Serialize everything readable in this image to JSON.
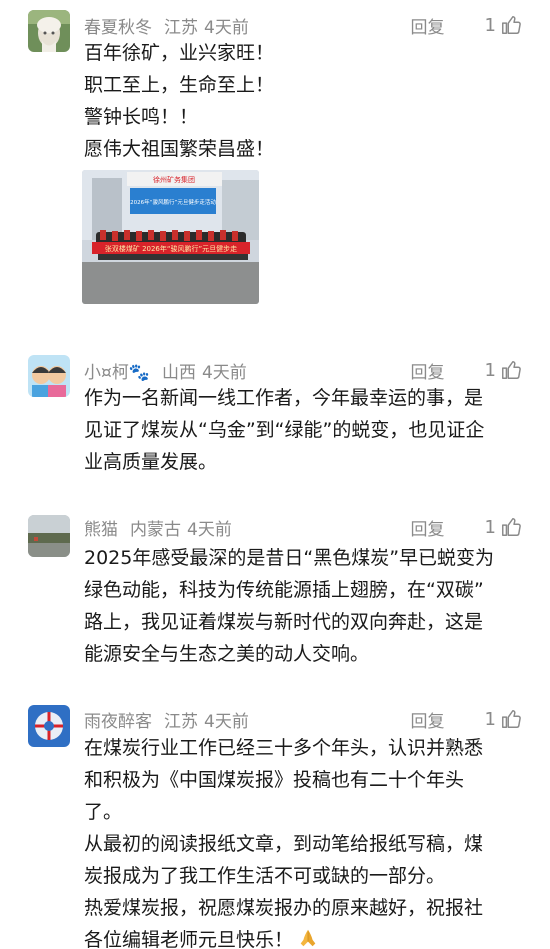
{
  "comments": [
    {
      "user": "春夏秋冬",
      "location": "江苏",
      "time": "4天前",
      "reply_label": "回复",
      "likes": "1",
      "lines": [
        "百年徐矿，业兴家旺！",
        "职工至上，生命至上！",
        "警钟长鸣！！",
        "愿伟大祖国繁荣昌盛！"
      ],
      "photo": {
        "banner_text": "张双楼煤矿 2026年“骏风鹏行”元旦健步走",
        "screen_text": "2026年“骏风鹏行”元旦健步走活动",
        "logo_text": "徐州矿务集团"
      }
    },
    {
      "user": "小¤柯🐾",
      "location": "山西",
      "time": "4天前",
      "reply_label": "回复",
      "likes": "1",
      "lines": [
        "作为一名新闻一线工作者，今年最幸运的事，是",
        "见证了煤炭从“乌金”到“绿能”的蜕变，也见证企",
        "业高质量发展。"
      ]
    },
    {
      "user": "熊猫",
      "location": "内蒙古",
      "time": "4天前",
      "reply_label": "回复",
      "likes": "1",
      "lines": [
        "2025年感受最深的是昔日“黑色煤炭”早已蜕变为",
        "绿色动能，科技为传统能源插上翅膀，在“双碳”",
        "路上，我见证着煤炭与新时代的双向奔赴，这是",
        "能源安全与生态之美的动人交响。"
      ]
    },
    {
      "user": "雨夜醉客",
      "location": "江苏",
      "time": "4天前",
      "reply_label": "回复",
      "likes": "1",
      "lines": [
        "在煤炭行业工作已经三十多个年头，认识并熟悉",
        "和积极为《中国煤炭报》投稿也有二十个年头",
        "了。",
        "从最初的阅读报纸文章，到动笔给报纸写稿，煤",
        "炭报成为了我工作生活不可或缺的一部分。",
        "热爱煤炭报，祝愿煤炭报办的原来越好，祝报社",
        "各位编辑老师元旦快乐！"
      ],
      "emoji": "folded-hands"
    }
  ],
  "colors": {
    "meta": "#8a8a8a",
    "text": "#1a1a1a",
    "banner": "#d8232a"
  }
}
